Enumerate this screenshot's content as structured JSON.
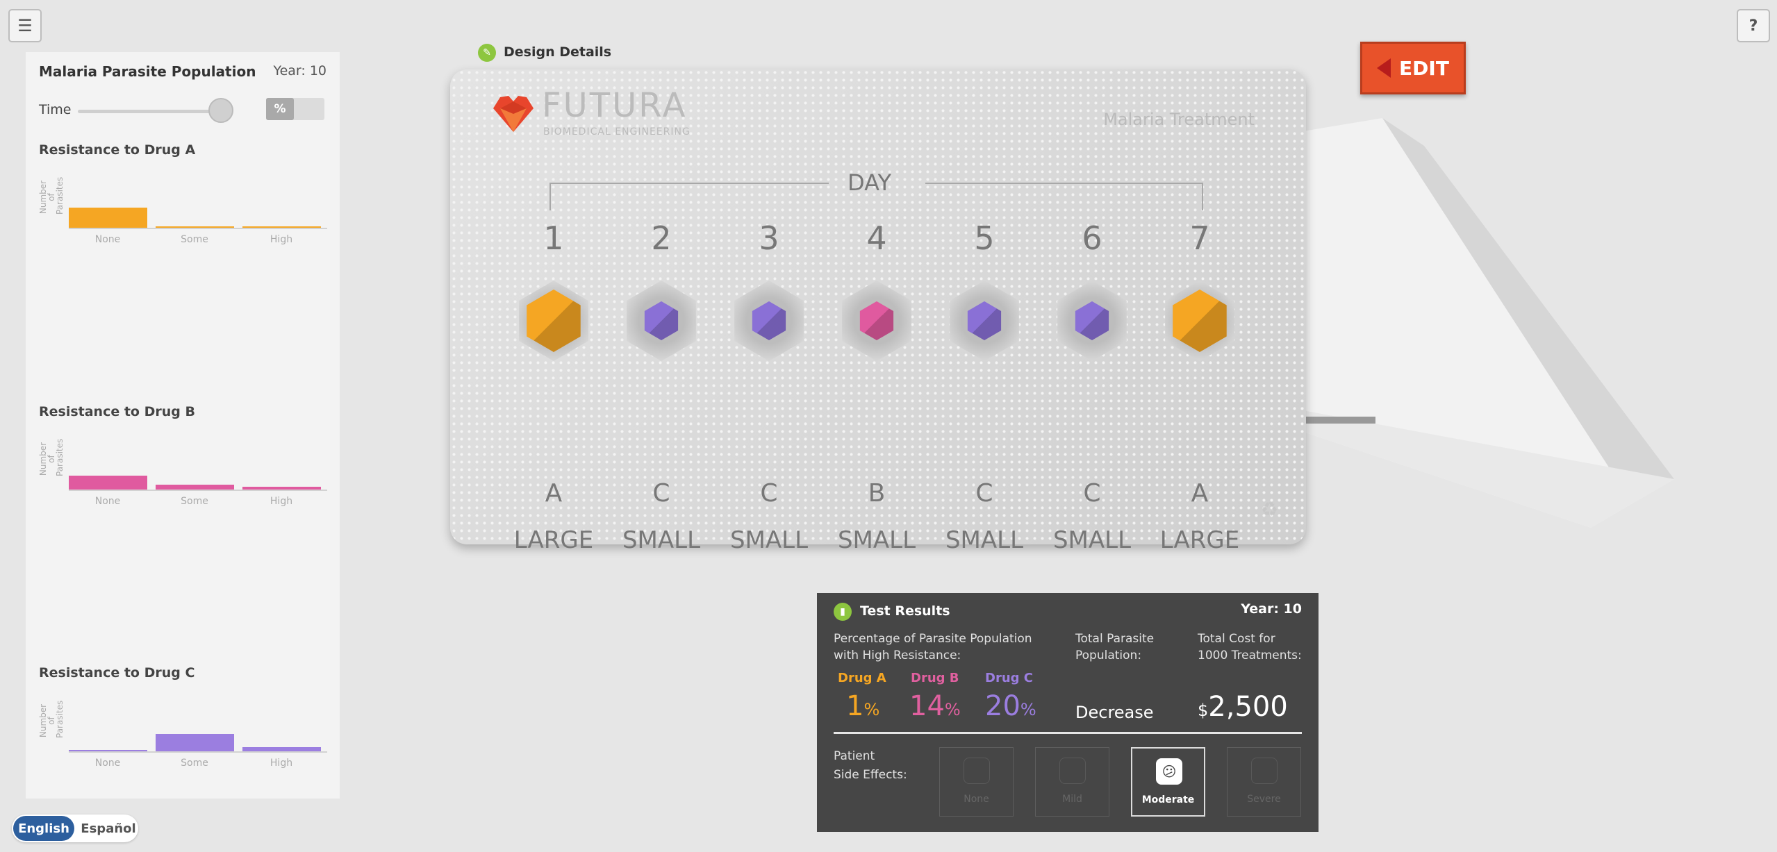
{
  "topbar": {
    "menu_icon": "hamburger-menu-icon",
    "help_label": "?"
  },
  "left_panel": {
    "title": "Malaria Parasite Population",
    "year": "Year: 10",
    "time_label": "Time",
    "percent_toggle": "%",
    "y_axis_label": "Number of Parasites",
    "categories": [
      "None",
      "Some",
      "High"
    ],
    "charts": [
      {
        "title": "Resistance to Drug A",
        "color": "#f5a623",
        "values": [
          0.92,
          0.06,
          0.02
        ]
      },
      {
        "title": "Resistance to Drug B",
        "color": "#e05a9f",
        "values": [
          0.64,
          0.22,
          0.14
        ]
      },
      {
        "title": "Resistance to Drug C",
        "color": "#9b7ee0",
        "values": [
          0.02,
          0.78,
          0.2
        ]
      }
    ]
  },
  "language": {
    "english": "English",
    "spanish": "Español"
  },
  "design": {
    "header": "Design Details",
    "brand_name": "FUTURA",
    "brand_sub": "BIOMEDICAL ENGINEERING",
    "product": "Malaria Treatment",
    "day_label": "DAY",
    "days": [
      {
        "num": "1",
        "drug": "A",
        "size": "LARGE",
        "color": "#f5a623"
      },
      {
        "num": "2",
        "drug": "C",
        "size": "SMALL",
        "color": "#8a70d6"
      },
      {
        "num": "3",
        "drug": "C",
        "size": "SMALL",
        "color": "#8a70d6"
      },
      {
        "num": "4",
        "drug": "B",
        "size": "SMALL",
        "color": "#e05a9f"
      },
      {
        "num": "5",
        "drug": "C",
        "size": "SMALL",
        "color": "#8a70d6"
      },
      {
        "num": "6",
        "drug": "C",
        "size": "SMALL",
        "color": "#8a70d6"
      },
      {
        "num": "7",
        "drug": "A",
        "size": "LARGE",
        "color": "#f5a623"
      }
    ],
    "edit_label": "EDIT"
  },
  "test_results": {
    "title": "Test Results",
    "year": "Year: 10",
    "pct_header_1": "Percentage of Parasite Population",
    "pct_header_2": "with High Resistance:",
    "pop_header_1": "Total Parasite",
    "pop_header_2": "Population:",
    "cost_header_1": "Total Cost for",
    "cost_header_2": "1000 Treatments:",
    "drugs": [
      {
        "name": "Drug A",
        "value": "1",
        "color": "#f5a623"
      },
      {
        "name": "Drug B",
        "value": "14",
        "color": "#e0609f"
      },
      {
        "name": "Drug C",
        "value": "20",
        "color": "#9b7ee0"
      }
    ],
    "percent_sign": "%",
    "population": "Decrease",
    "currency": "$",
    "cost": "2,500",
    "side_effects_label_1": "Patient",
    "side_effects_label_2": "Side Effects:",
    "side_effects": [
      "None",
      "Mild",
      "Moderate",
      "Severe"
    ],
    "selected_side_effect": "Moderate"
  }
}
